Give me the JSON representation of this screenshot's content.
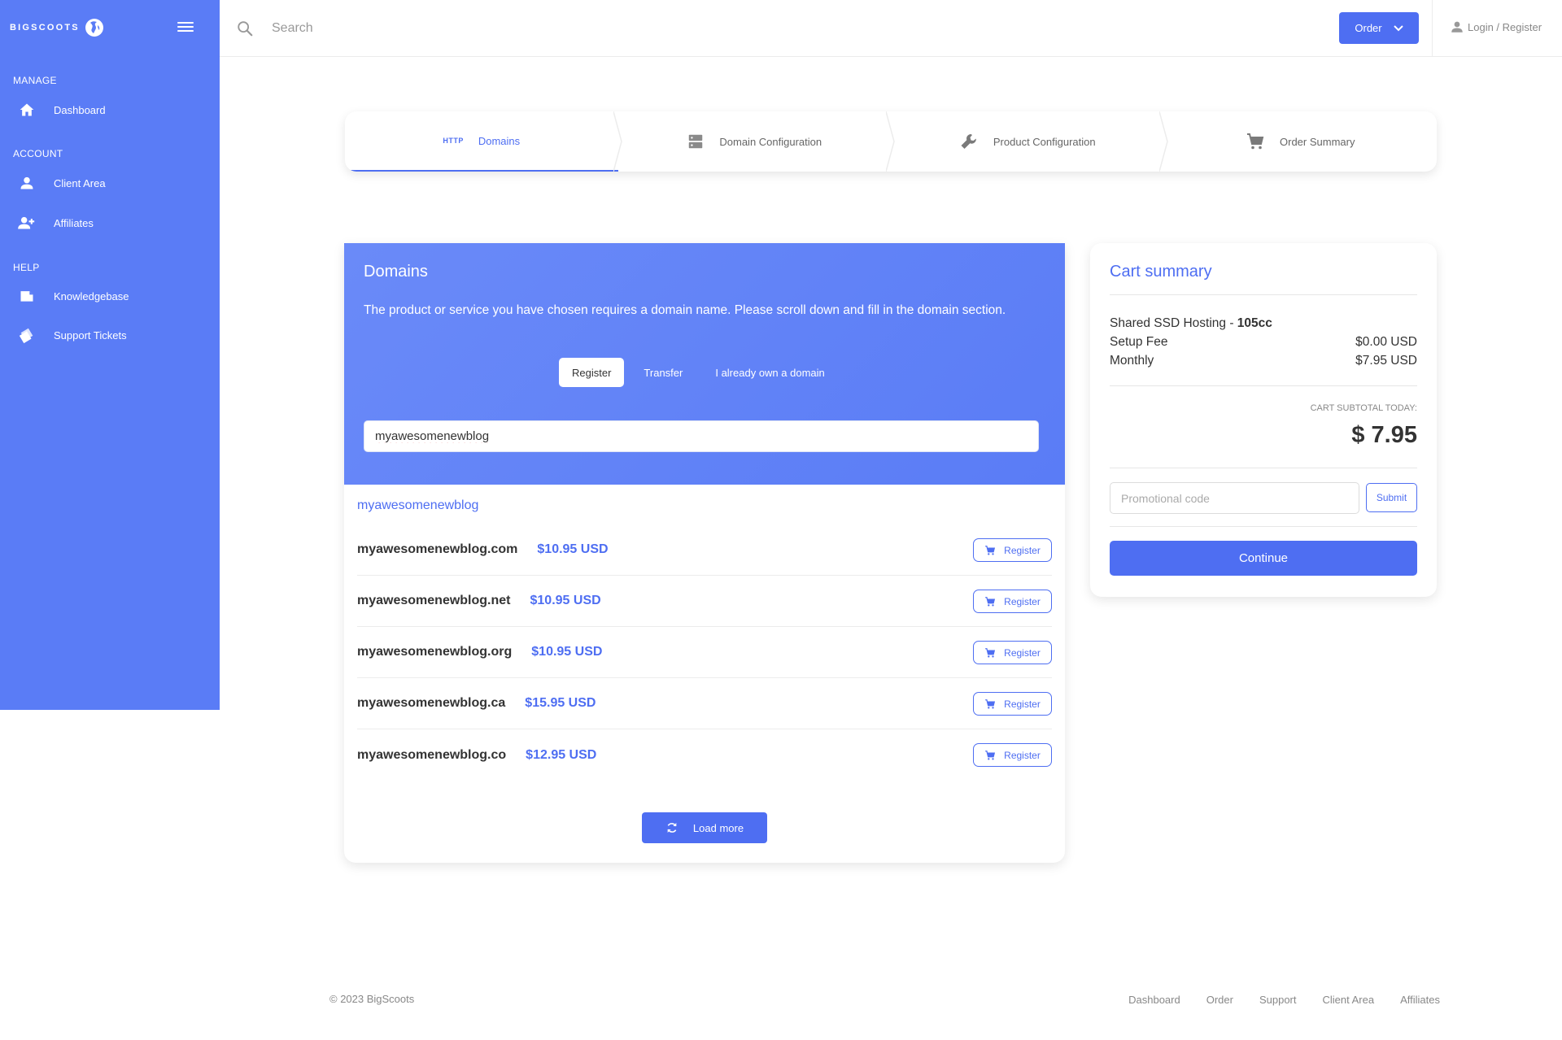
{
  "brand": {
    "name": "BIGSCOOTS",
    "logo_icon": "bigscoots-globe-logo"
  },
  "colors": {
    "primary": "#4e6ef2",
    "sidebar": "#5a7cf6",
    "text": "#333333",
    "muted": "#888888"
  },
  "sidebar": {
    "sections": [
      {
        "title": "MANAGE",
        "items": [
          {
            "label": "Dashboard",
            "icon": "home-icon"
          }
        ]
      },
      {
        "title": "ACCOUNT",
        "items": [
          {
            "label": "Client Area",
            "icon": "user-icon"
          },
          {
            "label": "Affiliates",
            "icon": "user-plus-icon"
          }
        ]
      },
      {
        "title": "HELP",
        "items": [
          {
            "label": "Knowledgebase",
            "icon": "book-icon"
          },
          {
            "label": "Support Tickets",
            "icon": "tickets-icon"
          }
        ]
      }
    ]
  },
  "header": {
    "search_placeholder": "Search",
    "order_label": "Order",
    "login_label": "Login / Register"
  },
  "steps": [
    {
      "label": "Domains",
      "badge": "HTTP",
      "active": true
    },
    {
      "label": "Domain Configuration",
      "icon": "server-icon"
    },
    {
      "label": "Product Configuration",
      "icon": "wrench-icon"
    },
    {
      "label": "Order Summary",
      "icon": "cart-icon"
    }
  ],
  "domains": {
    "title": "Domains",
    "description": "The product or service you have chosen requires a domain name. Please scroll down and fill in the domain section.",
    "tabs": [
      "Register",
      "Transfer",
      "I already own a domain"
    ],
    "active_tab": "Register",
    "input_value": "myawesomenewblog",
    "suggestion_title": "myawesomenewblog",
    "results": [
      {
        "name": "myawesomenewblog.com",
        "price": "$10.95 USD",
        "action": "Register"
      },
      {
        "name": "myawesomenewblog.net",
        "price": "$10.95 USD",
        "action": "Register"
      },
      {
        "name": "myawesomenewblog.org",
        "price": "$10.95 USD",
        "action": "Register"
      },
      {
        "name": "myawesomenewblog.ca",
        "price": "$15.95 USD",
        "action": "Register"
      },
      {
        "name": "myawesomenewblog.co",
        "price": "$12.95 USD",
        "action": "Register"
      }
    ],
    "load_more_label": "Load more"
  },
  "cart": {
    "title": "Cart summary",
    "product_prefix": "Shared SSD Hosting - ",
    "product_plan": "105cc",
    "setup_fee_label": "Setup Fee",
    "setup_fee_value": "$0.00 USD",
    "monthly_label": "Monthly",
    "monthly_value": "$7.95 USD",
    "subtotal_label": "CART SUBTOTAL TODAY:",
    "subtotal_value": "$ 7.95",
    "promo_placeholder": "Promotional code",
    "promo_submit": "Submit",
    "continue_label": "Continue"
  },
  "footer": {
    "copyright": "© 2023 BigScoots",
    "links": [
      "Dashboard",
      "Order",
      "Support",
      "Client Area",
      "Affiliates"
    ]
  }
}
